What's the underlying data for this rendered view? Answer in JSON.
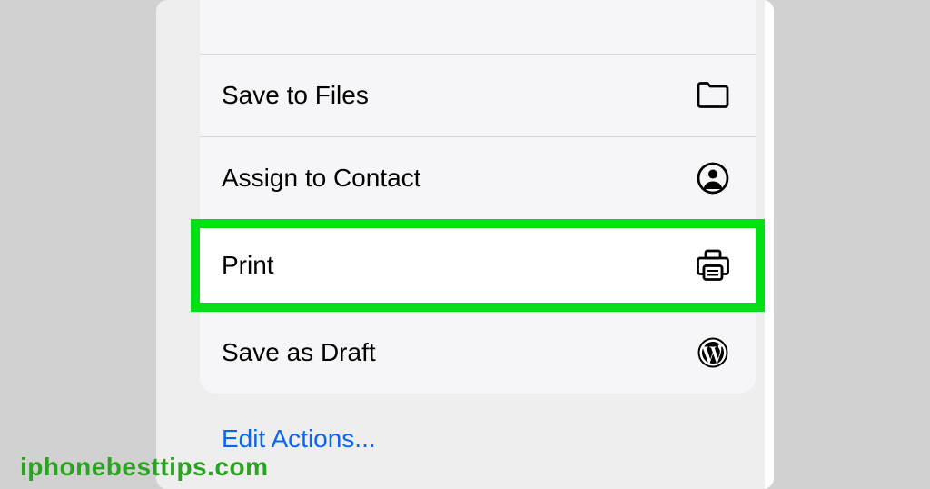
{
  "menu": {
    "items": [
      {
        "label": "Save to Files",
        "highlighted": false
      },
      {
        "label": "Assign to Contact",
        "highlighted": false
      },
      {
        "label": "Print",
        "highlighted": true
      },
      {
        "label": "Save as Draft",
        "highlighted": false
      }
    ]
  },
  "editActions": {
    "label": "Edit Actions..."
  },
  "watermark": "iphonebesttips.com"
}
